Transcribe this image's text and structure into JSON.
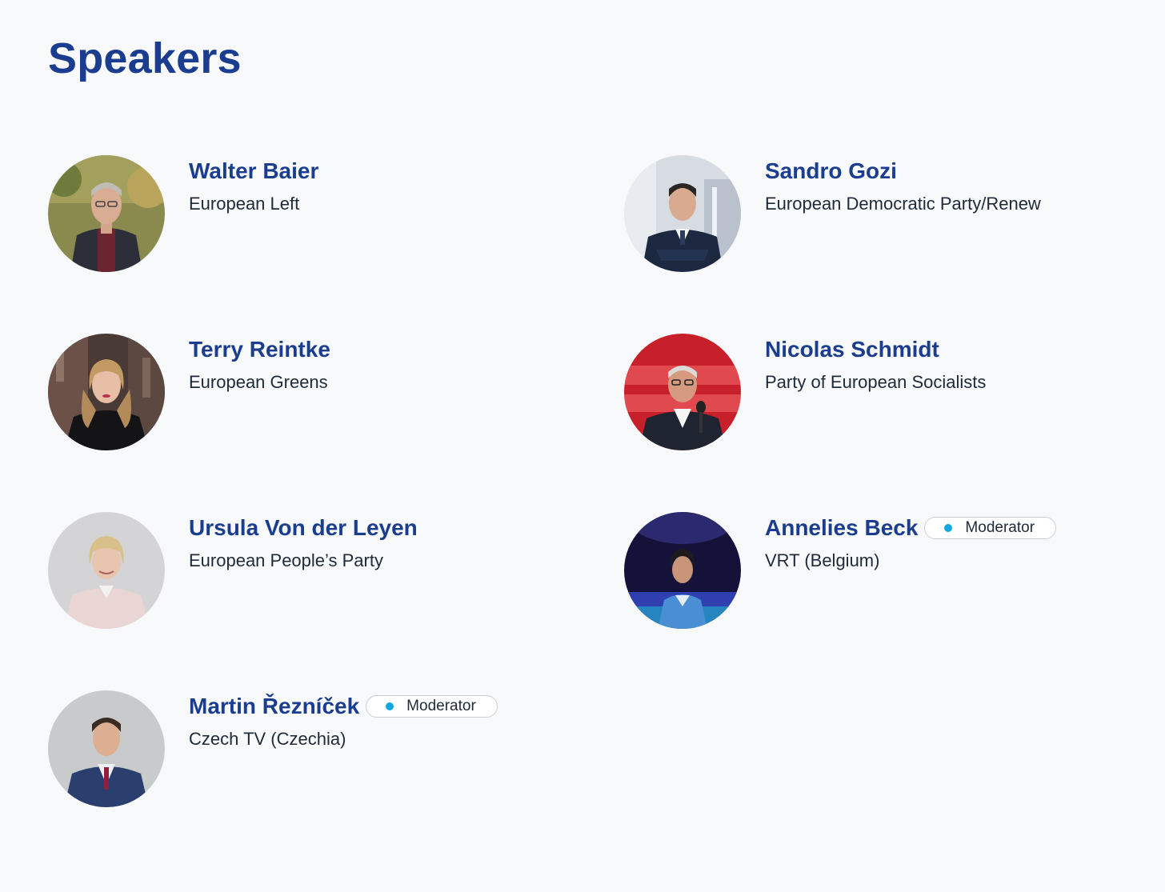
{
  "page": {
    "title": "Speakers"
  },
  "speakers": [
    {
      "name": "Walter Baier",
      "organization": "European Left",
      "badge": null
    },
    {
      "name": "Sandro Gozi",
      "organization": "European Democratic Party/Renew",
      "badge": null
    },
    {
      "name": "Terry Reintke",
      "organization": "European Greens",
      "badge": null
    },
    {
      "name": "Nicolas Schmidt",
      "organization": "Party of European Socialists",
      "badge": null
    },
    {
      "name": "Ursula Von der Leyen",
      "organization": "European People’s Party",
      "badge": null
    },
    {
      "name": "Annelies Beck",
      "organization": "VRT (Belgium)",
      "badge": "Moderator"
    },
    {
      "name": "Martin Řezníček",
      "organization": "Czech TV (Czechia)",
      "badge": "Moderator"
    }
  ],
  "colors": {
    "background": "#f8f9fb",
    "heading": "#1b3d8f",
    "text": "#1e2a3a",
    "badge_dot": "#12a8e0",
    "badge_border": "#c9ced6"
  }
}
